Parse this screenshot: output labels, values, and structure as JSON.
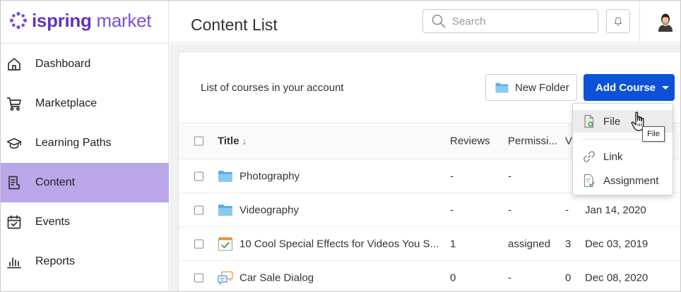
{
  "brand": {
    "logo_word1": "ispring",
    "logo_word2": "market",
    "accent": "#7a4fd1"
  },
  "sidebar": {
    "items": [
      {
        "label": "Dashboard",
        "icon": "home-icon"
      },
      {
        "label": "Marketplace",
        "icon": "cart-icon"
      },
      {
        "label": "Learning Paths",
        "icon": "graduation-cap-icon"
      },
      {
        "label": "Content",
        "icon": "content-list-icon",
        "active": true
      },
      {
        "label": "Events",
        "icon": "calendar-check-icon"
      },
      {
        "label": "Reports",
        "icon": "bar-chart-icon"
      }
    ],
    "active_color": "#bba6ea"
  },
  "header": {
    "title": "Content List",
    "search_placeholder": "Search"
  },
  "main": {
    "subtitle": "List of courses in your account",
    "new_folder_label": "New Folder",
    "add_course_label": "Add Course",
    "primary_color": "#0b52d8"
  },
  "table": {
    "columns": {
      "title": "Title",
      "sort_indicator": "↓",
      "reviews": "Reviews",
      "permissions": "Permissi...",
      "views": "V"
    },
    "rows": [
      {
        "title": "Photography",
        "type": "folder",
        "reviews": "-",
        "permissions": "-",
        "views": "",
        "date": ""
      },
      {
        "title": "Videography",
        "type": "folder",
        "reviews": "-",
        "permissions": "-",
        "views": "-",
        "date": "Jan 14, 2020"
      },
      {
        "title": "10 Cool Special Effects for Videos You S...",
        "type": "course",
        "reviews": "1",
        "permissions": "assigned",
        "views": "3",
        "date": "Dec 03, 2019"
      },
      {
        "title": "Car Sale Dialog",
        "type": "dialog",
        "reviews": "0",
        "permissions": "-",
        "views": "0",
        "date": "Dec 08, 2020"
      }
    ]
  },
  "dropdown": {
    "items": [
      {
        "label": "File",
        "icon": "file-add-icon"
      },
      {
        "label": "Link",
        "icon": "link-icon"
      },
      {
        "label": "Assignment",
        "icon": "assignment-icon"
      }
    ],
    "tooltip": "File"
  }
}
